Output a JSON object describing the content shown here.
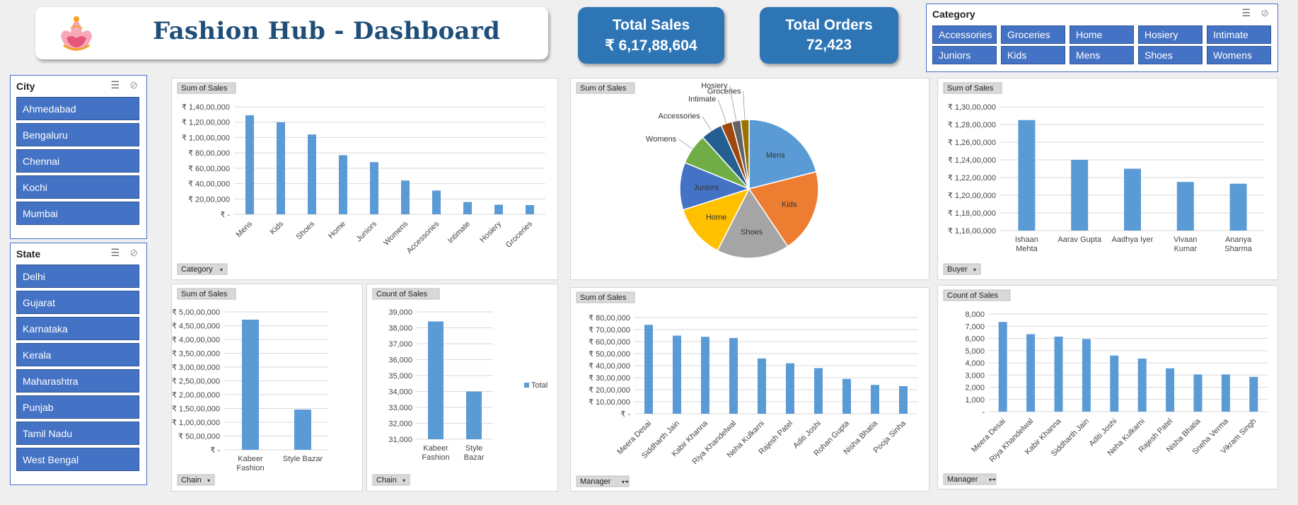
{
  "header": {
    "title": "Fashion Hub - Dashboard"
  },
  "kpis": {
    "total_sales": {
      "label": "Total Sales",
      "value": "₹ 6,17,88,604"
    },
    "total_orders": {
      "label": "Total Orders",
      "value": "72,423"
    }
  },
  "slicers": {
    "category": {
      "title": "Category",
      "items": [
        "Accessories",
        "Groceries",
        "Home",
        "Hosiery",
        "Intimate",
        "Juniors",
        "Kids",
        "Mens",
        "Shoes",
        "Womens"
      ]
    },
    "city": {
      "title": "City",
      "items": [
        "Ahmedabad",
        "Bengaluru",
        "Chennai",
        "Kochi",
        "Mumbai"
      ]
    },
    "state": {
      "title": "State",
      "items": [
        "Delhi",
        "Gujarat",
        "Karnataka",
        "Kerala",
        "Maharashtra",
        "Punjab",
        "Tamil Nadu",
        "West Bengal"
      ]
    }
  },
  "colors": {
    "accent": "#2e75b6",
    "slicer": "#4472c4",
    "bar": "#5b9bd5"
  },
  "chart_data": [
    {
      "id": "cat",
      "type": "bar",
      "value_label": "Sum of Sales",
      "field_button": "Category",
      "categories": [
        "Mens",
        "Kids",
        "Shoes",
        "Home",
        "Juniors",
        "Womens",
        "Accessories",
        "Intimate",
        "Hosiery",
        "Groceries"
      ],
      "values": [
        12900000,
        12000000,
        10400000,
        7700000,
        6800000,
        4400000,
        3100000,
        1600000,
        1250000,
        1200000
      ],
      "ylim": [
        0,
        14000000
      ],
      "yticks": [
        "₹ -",
        "₹ 20,00,000",
        "₹ 40,00,000",
        "₹ 60,00,000",
        "₹ 80,00,000",
        "₹ 1,00,00,000",
        "₹ 1,20,00,000",
        "₹ 1,40,00,000"
      ]
    },
    {
      "id": "pie",
      "type": "pie",
      "value_label": "Sum of Sales",
      "categories": [
        "Mens",
        "Kids",
        "Shoes",
        "Home",
        "Juniors",
        "Womens",
        "Accessories",
        "Intimate",
        "Hosiery",
        "Groceries"
      ],
      "values": [
        12900000,
        12000000,
        10400000,
        7700000,
        6800000,
        4400000,
        3100000,
        1600000,
        1250000,
        1200000
      ],
      "colors": [
        "#5b9bd5",
        "#ed7d31",
        "#a5a5a5",
        "#ffc000",
        "#4472c4",
        "#70ad47",
        "#255e91",
        "#9e480e",
        "#636363",
        "#997300"
      ]
    },
    {
      "id": "buyer",
      "type": "bar",
      "value_label": "Sum of Sales",
      "field_button": "Buyer",
      "categories": [
        "Ishaan Mehta",
        "Aarav Gupta",
        "Aadhya Iyer",
        "Vivaan Kumar",
        "Ananya Sharma"
      ],
      "values": [
        12850000,
        12400000,
        12300000,
        12150000,
        12130000
      ],
      "ylim": [
        11600000,
        13000000
      ],
      "yticks": [
        "₹ 1,16,00,000",
        "₹ 1,18,00,000",
        "₹ 1,20,00,000",
        "₹ 1,22,00,000",
        "₹ 1,24,00,000",
        "₹ 1,26,00,000",
        "₹ 1,28,00,000",
        "₹ 1,30,00,000"
      ]
    },
    {
      "id": "chain_sum",
      "type": "bar",
      "value_label": "Sum of Sales",
      "field_button": "Chain",
      "categories": [
        "Kabeer Fashion",
        "Style Bazar"
      ],
      "values": [
        47200000,
        14600000
      ],
      "ylim": [
        0,
        50000000
      ],
      "yticks": [
        "₹ -",
        "₹ 50,00,000",
        "₹ 1,00,00,000",
        "₹ 1,50,00,000",
        "₹ 2,00,00,000",
        "₹ 2,50,00,000",
        "₹ 3,00,00,000",
        "₹ 3,50,00,000",
        "₹ 4,00,00,000",
        "₹ 4,50,00,000",
        "₹ 5,00,00,000"
      ]
    },
    {
      "id": "chain_count",
      "type": "bar",
      "value_label": "Count of Sales",
      "field_button": "Chain",
      "legend": "Total",
      "categories": [
        "Kabeer Fashion",
        "Style Bazar"
      ],
      "values": [
        38400,
        34000
      ],
      "ylim": [
        31000,
        39000
      ],
      "yticks": [
        "31,000",
        "32,000",
        "33,000",
        "34,000",
        "35,000",
        "36,000",
        "37,000",
        "38,000",
        "39,000"
      ]
    },
    {
      "id": "mgr_sum",
      "type": "bar",
      "value_label": "Sum of Sales",
      "field_button": "Manager",
      "categories": [
        "Meera Desai",
        "Siddharth Jain",
        "Kabir Khanna",
        "Riya Khandelwal",
        "Neha Kulkarni",
        "Rajesh Patel",
        "Aditi Joshi",
        "Rohan Gupta",
        "Nisha Bhatia",
        "Pooja Sinha"
      ],
      "values": [
        7400000,
        6500000,
        6400000,
        6300000,
        4600000,
        4200000,
        3800000,
        2900000,
        2400000,
        2300000
      ],
      "ylim": [
        0,
        8000000
      ],
      "yticks": [
        "₹ -",
        "₹ 10,00,000",
        "₹ 20,00,000",
        "₹ 30,00,000",
        "₹ 40,00,000",
        "₹ 50,00,000",
        "₹ 60,00,000",
        "₹ 70,00,000",
        "₹ 80,00,000"
      ]
    },
    {
      "id": "mgr_count",
      "type": "bar",
      "value_label": "Count of Sales",
      "field_button": "Manager",
      "categories": [
        "Meera Desai",
        "Riya Khandelwal",
        "Kabir Khanna",
        "Siddharth Jain",
        "Aditi Joshi",
        "Neha Kulkarni",
        "Rajesh Patel",
        "Nisha Bhatia",
        "Sneha Verma",
        "Vikram Singh"
      ],
      "values": [
        7350,
        6350,
        6150,
        5950,
        4600,
        4350,
        3550,
        3050,
        3050,
        2850
      ],
      "ylim": [
        0,
        8000
      ],
      "yticks": [
        "-",
        "1,000",
        "2,000",
        "3,000",
        "4,000",
        "5,000",
        "6,000",
        "7,000",
        "8,000"
      ]
    }
  ]
}
